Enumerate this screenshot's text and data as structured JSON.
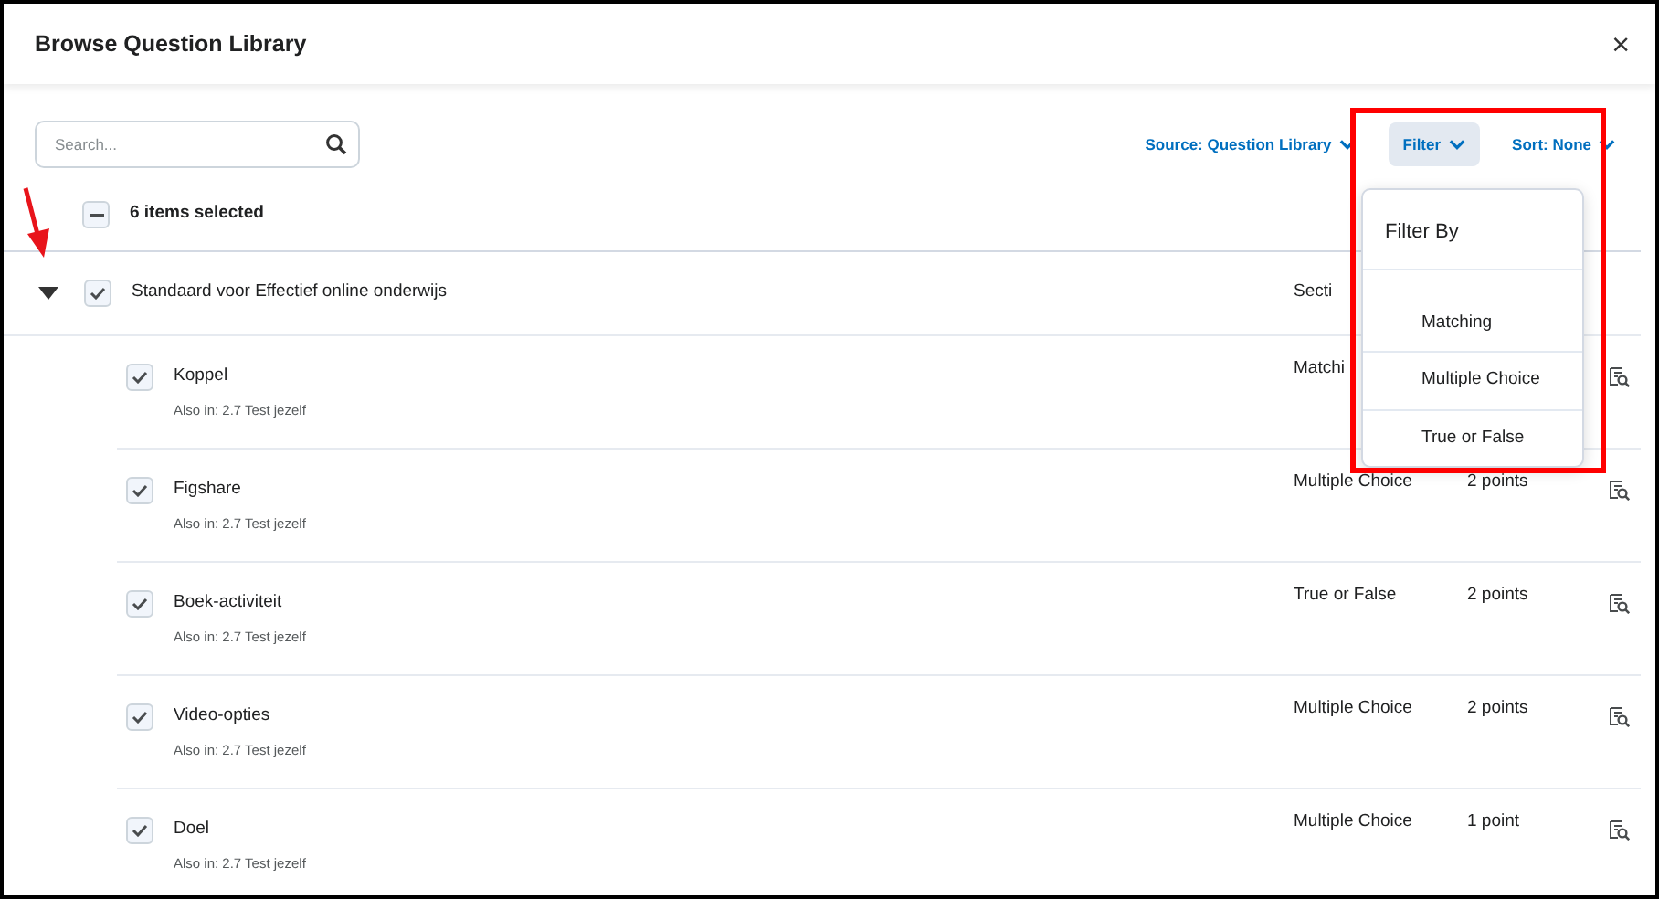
{
  "dialog": {
    "title": "Browse Question Library",
    "close": "×"
  },
  "search": {
    "placeholder": "Search..."
  },
  "toolbar": [
    {
      "label": "Source: Question Library",
      "selected": false
    },
    {
      "label": "Filter",
      "selected": true
    },
    {
      "label": "Sort: None",
      "selected": false
    }
  ],
  "selection": {
    "label": "6 items selected",
    "indeterminate": true
  },
  "section": {
    "title": "Standaard voor Effectief online onderwijs",
    "type": "Secti",
    "expanded": true,
    "checked": true
  },
  "questions": [
    {
      "title": "Koppel",
      "also_in": "Also in: 2.7 Test jezelf",
      "type": "Matchi",
      "checked": true
    },
    {
      "title": "Figshare",
      "also_in": "Also in: 2.7 Test jezelf",
      "type": "Multiple Choice",
      "points": "2 points",
      "checked": true
    },
    {
      "title": "Boek-activiteit",
      "also_in": "Also in: 2.7 Test jezelf",
      "type": "True or False",
      "points": "2 points",
      "checked": true
    },
    {
      "title": "Video-opties",
      "also_in": "Also in: 2.7 Test jezelf",
      "type": "Multiple Choice",
      "points": "2 points",
      "checked": true
    },
    {
      "title": "Doel",
      "also_in": "Also in: 2.7 Test jezelf",
      "type": "Multiple Choice",
      "points": "1 point",
      "checked": true
    }
  ],
  "filter_menu": {
    "title": "Filter By",
    "options": [
      "Matching",
      "Multiple Choice",
      "True or False"
    ]
  }
}
